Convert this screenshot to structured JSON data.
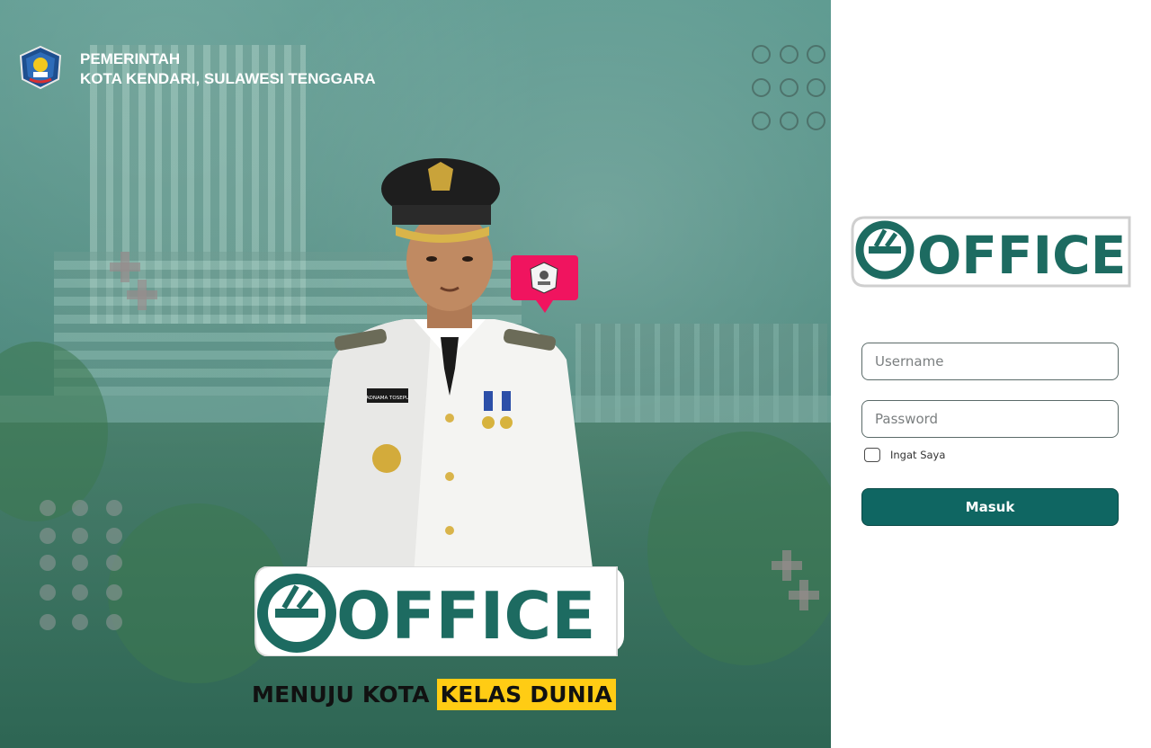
{
  "header": {
    "gov_line1": "PEMERINTAH",
    "gov_line2": "KOTA KENDARI, SULAWESI TENGGARA"
  },
  "hero": {
    "logo_text": "OFFICE",
    "slogan_part1": "MENUJU KOTA",
    "slogan_part2": "KELAS DUNIA",
    "name_tag": "ADNAMA TOSEPU"
  },
  "login": {
    "logo_text": "OFFICE",
    "username_placeholder": "Username",
    "password_placeholder": "Password",
    "remember_label": "Ingat Saya",
    "submit_label": "Masuk"
  },
  "colors": {
    "brand_green": "#0f6662",
    "hero_bg": "#4f8b80",
    "highlight_yellow": "#ffcc14",
    "pin_pink": "#f0145f"
  },
  "icons": [
    "government-emblem-icon",
    "e-office-logo-icon",
    "location-pin-icon"
  ]
}
